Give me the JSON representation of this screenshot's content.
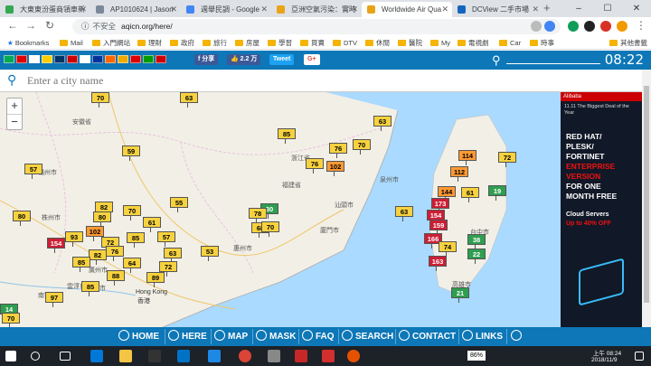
{
  "tabs": [
    {
      "title": "大東東汾蛋商領車新",
      "color": "#34a853"
    },
    {
      "title": "AP1010624 | Jason",
      "color": "#7b8a9a"
    },
    {
      "title": "週舉民調 - Google",
      "color": "#4285f4"
    },
    {
      "title": "亞洲空氣污染：實時",
      "color": "#e8a317"
    },
    {
      "title": "Worldwide Air Qua",
      "color": "#e8a317"
    },
    {
      "title": "DCView 二手市場",
      "color": "#1565c0"
    }
  ],
  "browser": {
    "url": "aqicn.org/here/",
    "insecure_label": "不安全",
    "new_tab": "+"
  },
  "window_controls": {
    "minimize": "–",
    "maximize": "☐",
    "close": "✕"
  },
  "bookmarks": [
    "Bookmarks",
    "Mail",
    "入門網站",
    "理財",
    "政府",
    "旅行",
    "房屋",
    "學習",
    "買賣",
    "DTV",
    "休閒",
    "醫院",
    "My",
    "電視劇",
    "Car",
    "時事",
    "其他書籤"
  ],
  "header": {
    "share_fb": "分享",
    "like_count": "2.2 万",
    "tweet": "Tweet",
    "gplus": "G+",
    "time": "08:22",
    "flags": [
      "#0a5",
      "#d00",
      "#fff",
      "#fc0",
      "#036",
      "#c00",
      "#fff",
      "#039",
      "#f60",
      "#ea0",
      "#d00",
      "#090",
      "#c00"
    ]
  },
  "search": {
    "placeholder": "Enter a city name"
  },
  "zoom": {
    "in": "+",
    "out": "−"
  },
  "map_labels": [
    "Hong Kong",
    "香港"
  ],
  "map_cities": [
    "安徽省",
    "浙江省",
    "贛州市",
    "株州市",
    "福建省",
    "廈門市",
    "廣州市",
    "惠州市",
    "汕頭市",
    "雲浮市",
    "江門市",
    "南寧市",
    "泉州市",
    "台中市",
    "高雄市"
  ],
  "markers": [
    {
      "v": "70",
      "c": "#f7d23e"
    },
    {
      "v": "63",
      "c": "#f7d23e"
    },
    {
      "v": "57",
      "c": "#f7d23e"
    },
    {
      "v": "59",
      "c": "#f7d23e"
    },
    {
      "v": "85",
      "c": "#f7d23e"
    },
    {
      "v": "76",
      "c": "#f7d23e"
    },
    {
      "v": "70",
      "c": "#f7d23e"
    },
    {
      "v": "63",
      "c": "#f7d23e"
    },
    {
      "v": "76",
      "c": "#f7d23e"
    },
    {
      "v": "102",
      "c": "#ff9933"
    },
    {
      "v": "80",
      "c": "#f7d23e"
    },
    {
      "v": "82",
      "c": "#f7d23e"
    },
    {
      "v": "70",
      "c": "#f7d23e"
    },
    {
      "v": "55",
      "c": "#f7d23e"
    },
    {
      "v": "30",
      "c": "#2e9e4f"
    },
    {
      "v": "154",
      "c": "#cc1f36"
    },
    {
      "v": "93",
      "c": "#f7d23e"
    },
    {
      "v": "102",
      "c": "#ff9933"
    },
    {
      "v": "80",
      "c": "#f7d23e"
    },
    {
      "v": "61",
      "c": "#f7d23e"
    },
    {
      "v": "78",
      "c": "#f7d23e"
    },
    {
      "v": "68",
      "c": "#f7d23e"
    },
    {
      "v": "70",
      "c": "#f7d23e"
    },
    {
      "v": "85",
      "c": "#f7d23e"
    },
    {
      "v": "57",
      "c": "#f7d23e"
    },
    {
      "v": "72",
      "c": "#f7d23e"
    },
    {
      "v": "82",
      "c": "#f7d23e"
    },
    {
      "v": "76",
      "c": "#f7d23e"
    },
    {
      "v": "63",
      "c": "#f7d23e"
    },
    {
      "v": "53",
      "c": "#f7d23e"
    },
    {
      "v": "85",
      "c": "#f7d23e"
    },
    {
      "v": "64",
      "c": "#f7d23e"
    },
    {
      "v": "89",
      "c": "#f7d23e"
    },
    {
      "v": "72",
      "c": "#f7d23e"
    },
    {
      "v": "85",
      "c": "#f7d23e"
    },
    {
      "v": "88",
      "c": "#f7d23e"
    },
    {
      "v": "97",
      "c": "#f7d23e"
    },
    {
      "v": "14",
      "c": "#2e9e4f"
    },
    {
      "v": "70",
      "c": "#f7d23e"
    },
    {
      "v": "63",
      "c": "#f7d23e"
    },
    {
      "v": "114",
      "c": "#ff9933"
    },
    {
      "v": "72",
      "c": "#f7d23e"
    },
    {
      "v": "112",
      "c": "#ff9933"
    },
    {
      "v": "144",
      "c": "#ff9933"
    },
    {
      "v": "61",
      "c": "#f7d23e"
    },
    {
      "v": "19",
      "c": "#2e9e4f"
    },
    {
      "v": "173",
      "c": "#cc1f36"
    },
    {
      "v": "154",
      "c": "#cc1f36"
    },
    {
      "v": "159",
      "c": "#cc1f36"
    },
    {
      "v": "166",
      "c": "#cc1f36"
    },
    {
      "v": "74",
      "c": "#f7d23e"
    },
    {
      "v": "38",
      "c": "#2e9e4f"
    },
    {
      "v": "22",
      "c": "#2e9e4f"
    },
    {
      "v": "163",
      "c": "#cc1f36"
    },
    {
      "v": "21",
      "c": "#2e9e4f"
    }
  ],
  "ad": {
    "tag": "11.11 The Biggest Deal of the Year",
    "line1": "RED HAT/",
    "line2": "PLESK/",
    "line3": "FORTINET",
    "line4": "ENTERPRISE",
    "line5": "VERSION",
    "line6": "FOR ONE",
    "line7": "MONTH FREE",
    "line8": "Cloud Servers",
    "line9": "Up to 40% OFF",
    "brand": "Alibaba"
  },
  "nav": [
    "HOME",
    "HERE",
    "MAP",
    "MASK",
    "FAQ",
    "SEARCH",
    "CONTACT",
    "LINKS"
  ],
  "taskbar": {
    "battery": "86%",
    "time": "上午 08:24",
    "date": "2018/11/9"
  }
}
